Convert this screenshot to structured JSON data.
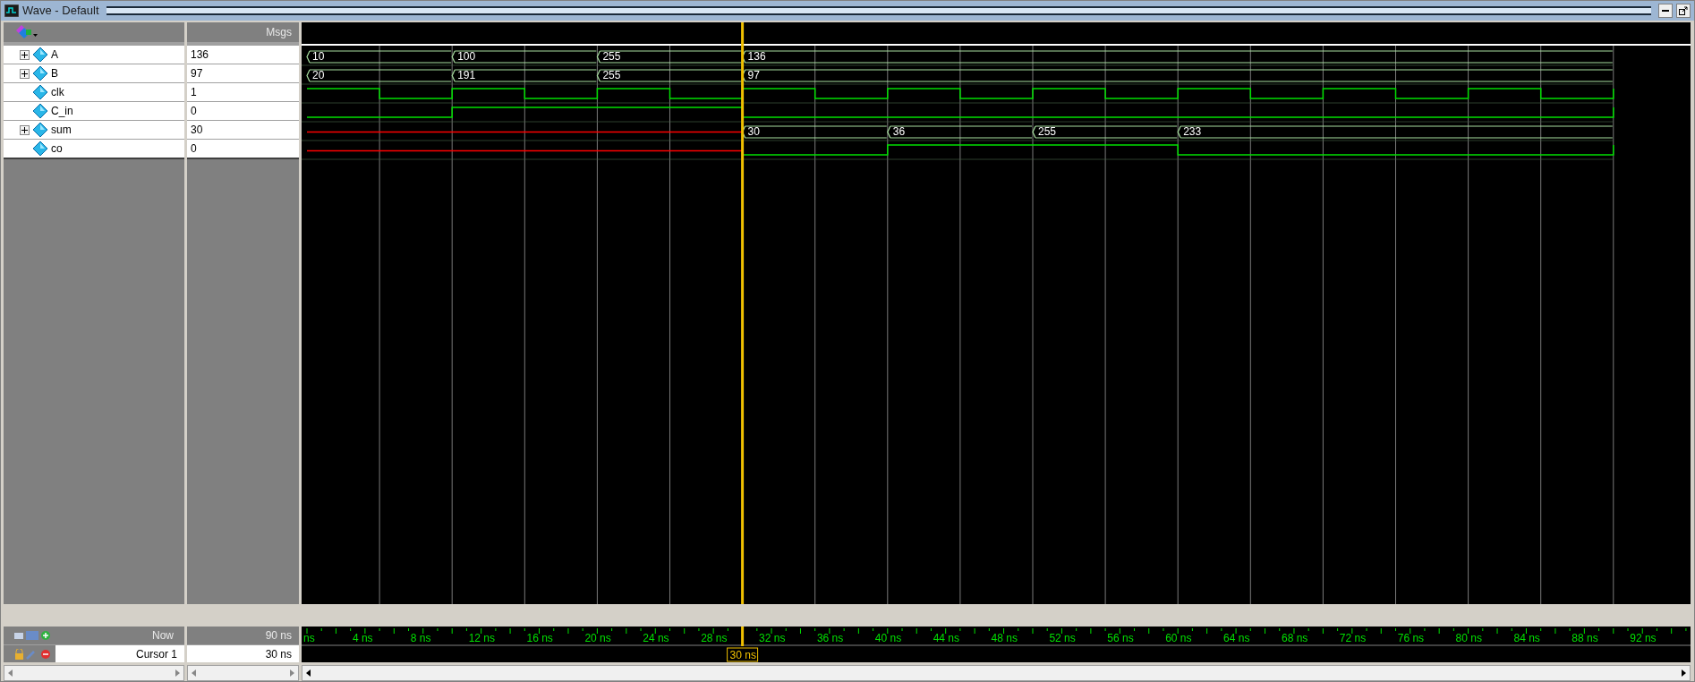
{
  "window": {
    "title": "Wave - Default"
  },
  "header": {
    "values_title": "Msgs"
  },
  "signals": [
    {
      "name": "A",
      "value": "136",
      "kind": "bus",
      "bus_values": [
        "10",
        "100",
        "255",
        "136"
      ]
    },
    {
      "name": "B",
      "value": "97",
      "kind": "bus",
      "bus_values": [
        "20",
        "191",
        "255",
        "97"
      ]
    },
    {
      "name": "clk",
      "value": "1",
      "kind": "bit"
    },
    {
      "name": "C_in",
      "value": "0",
      "kind": "bit"
    },
    {
      "name": "sum",
      "value": "30",
      "kind": "bus",
      "bus_values": [
        "30",
        "36",
        "255",
        "233"
      ]
    },
    {
      "name": "co",
      "value": "0",
      "kind": "bit"
    }
  ],
  "now": {
    "label": "Now",
    "value": "90 ns"
  },
  "cursor": {
    "label": "Cursor 1",
    "value": "30 ns",
    "flag": "30 ns"
  },
  "ruler": {
    "labels": [
      "ns",
      "4 ns",
      "8 ns",
      "12 ns",
      "16 ns",
      "20 ns",
      "24 ns",
      "28 ns",
      "32 ns",
      "36 ns",
      "40 ns",
      "44 ns",
      "48 ns",
      "52 ns",
      "56 ns",
      "60 ns",
      "64 ns",
      "68 ns",
      "72 ns",
      "76 ns",
      "80 ns",
      "84 ns",
      "88 ns",
      "92 ns"
    ]
  }
}
